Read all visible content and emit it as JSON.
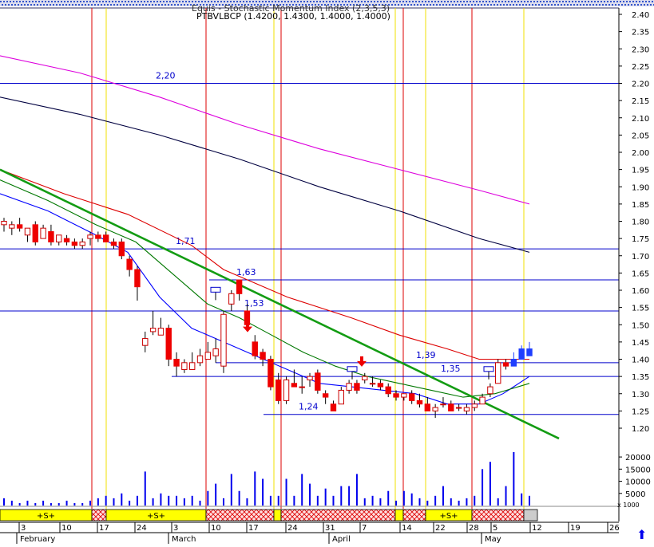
{
  "header": {
    "title": "Equis - Stochastic Momentum Index (2,3,5,3)",
    "subtitle": "PTBVLBCP (1.4200, 1.4300, 1.4000, 1.4000)"
  },
  "colors": {
    "price_up": "#ffffff",
    "price_down": "#ee0000",
    "recent_up": "#1f3fff",
    "hline": "#0000cc",
    "trendline": "#139c13",
    "ma_red": "#dd0000",
    "ma_magenta": "#dd00dd",
    "ma_black": "#000040",
    "ma_blue": "#0000ff",
    "ma_green": "#007700",
    "vline_red": "#dd0000",
    "vline_yellow": "#f0e000",
    "volume": "#0000ee",
    "signal_yellow": "#ffff00",
    "signal_hatch": "#dd0000"
  },
  "axis": {
    "right_ticks": [
      "2.40",
      "2.35",
      "2.30",
      "2.25",
      "2.20",
      "2.15",
      "2.10",
      "2.05",
      "2.00",
      "1.95",
      "1.90",
      "1.85",
      "1.80",
      "1.75",
      "1.70",
      "1.65",
      "1.60",
      "1.55",
      "1.50",
      "1.45",
      "1.40",
      "1.35",
      "1.30",
      "1.25",
      "1.20"
    ],
    "volume_ticks": [
      "20000",
      "15000",
      "10000",
      "5000"
    ],
    "volume_suffix": "x 1000",
    "date_ticks": [
      "3",
      "10",
      "17",
      "24",
      "3",
      "10",
      "17",
      "24",
      "31",
      "7",
      "14",
      "22",
      "28",
      "5",
      "12",
      "19",
      "26"
    ],
    "month_labels": [
      "February",
      "March",
      "April",
      "May"
    ]
  },
  "chart_data": {
    "type": "candlestick",
    "title": "Equis - Stochastic Momentum Index (2,3,5,3)",
    "subtitle": "PTBVLBCP (1.4200, 1.4300, 1.4000, 1.4000)",
    "ylim": [
      1.15,
      2.42
    ],
    "grid": false,
    "candles": [
      {
        "o": 1.79,
        "h": 1.81,
        "l": 1.77,
        "c": 1.8
      },
      {
        "o": 1.78,
        "h": 1.8,
        "l": 1.76,
        "c": 1.79
      },
      {
        "o": 1.79,
        "h": 1.81,
        "l": 1.77,
        "c": 1.78
      },
      {
        "o": 1.76,
        "h": 1.78,
        "l": 1.74,
        "c": 1.78
      },
      {
        "o": 1.79,
        "h": 1.8,
        "l": 1.73,
        "c": 1.74
      },
      {
        "o": 1.75,
        "h": 1.79,
        "l": 1.75,
        "c": 1.78
      },
      {
        "o": 1.77,
        "h": 1.79,
        "l": 1.73,
        "c": 1.74
      },
      {
        "o": 1.74,
        "h": 1.76,
        "l": 1.73,
        "c": 1.76
      },
      {
        "o": 1.75,
        "h": 1.76,
        "l": 1.73,
        "c": 1.74
      },
      {
        "o": 1.74,
        "h": 1.75,
        "l": 1.72,
        "c": 1.73
      },
      {
        "o": 1.73,
        "h": 1.75,
        "l": 1.72,
        "c": 1.74
      },
      {
        "o": 1.75,
        "h": 1.77,
        "l": 1.73,
        "c": 1.76
      },
      {
        "o": 1.76,
        "h": 1.77,
        "l": 1.74,
        "c": 1.75
      },
      {
        "o": 1.76,
        "h": 1.77,
        "l": 1.74,
        "c": 1.74
      },
      {
        "o": 1.74,
        "h": 1.75,
        "l": 1.72,
        "c": 1.73
      },
      {
        "o": 1.74,
        "h": 1.75,
        "l": 1.69,
        "c": 1.7
      },
      {
        "o": 1.69,
        "h": 1.7,
        "l": 1.64,
        "c": 1.66
      },
      {
        "o": 1.66,
        "h": 1.67,
        "l": 1.57,
        "c": 1.61
      },
      {
        "o": 1.44,
        "h": 1.48,
        "l": 1.42,
        "c": 1.46
      },
      {
        "o": 1.48,
        "h": 1.54,
        "l": 1.47,
        "c": 1.49
      },
      {
        "o": 1.47,
        "h": 1.52,
        "l": 1.47,
        "c": 1.49
      },
      {
        "o": 1.49,
        "h": 1.5,
        "l": 1.38,
        "c": 1.4
      },
      {
        "o": 1.4,
        "h": 1.42,
        "l": 1.35,
        "c": 1.38
      },
      {
        "o": 1.37,
        "h": 1.4,
        "l": 1.36,
        "c": 1.39
      },
      {
        "o": 1.37,
        "h": 1.42,
        "l": 1.37,
        "c": 1.39
      },
      {
        "o": 1.39,
        "h": 1.43,
        "l": 1.38,
        "c": 1.41
      },
      {
        "o": 1.4,
        "h": 1.45,
        "l": 1.4,
        "c": 1.42
      },
      {
        "o": 1.41,
        "h": 1.46,
        "l": 1.39,
        "c": 1.43
      },
      {
        "o": 1.38,
        "h": 1.54,
        "l": 1.36,
        "c": 1.53
      },
      {
        "o": 1.56,
        "h": 1.6,
        "l": 1.54,
        "c": 1.59
      },
      {
        "o": 1.63,
        "h": 1.63,
        "l": 1.57,
        "c": 1.59
      },
      {
        "o": 1.54,
        "h": 1.56,
        "l": 1.49,
        "c": 1.5
      },
      {
        "o": 1.45,
        "h": 1.47,
        "l": 1.4,
        "c": 1.41
      },
      {
        "o": 1.42,
        "h": 1.43,
        "l": 1.38,
        "c": 1.4
      },
      {
        "o": 1.4,
        "h": 1.41,
        "l": 1.31,
        "c": 1.32
      },
      {
        "o": 1.34,
        "h": 1.36,
        "l": 1.27,
        "c": 1.28
      },
      {
        "o": 1.28,
        "h": 1.35,
        "l": 1.27,
        "c": 1.34
      },
      {
        "o": 1.33,
        "h": 1.37,
        "l": 1.32,
        "c": 1.32
      },
      {
        "o": 1.32,
        "h": 1.35,
        "l": 1.3,
        "c": 1.32
      },
      {
        "o": 1.34,
        "h": 1.36,
        "l": 1.32,
        "c": 1.35
      },
      {
        "o": 1.36,
        "h": 1.37,
        "l": 1.3,
        "c": 1.31
      },
      {
        "o": 1.3,
        "h": 1.31,
        "l": 1.27,
        "c": 1.29
      },
      {
        "o": 1.27,
        "h": 1.28,
        "l": 1.25,
        "c": 1.25
      },
      {
        "o": 1.27,
        "h": 1.32,
        "l": 1.27,
        "c": 1.31
      },
      {
        "o": 1.31,
        "h": 1.34,
        "l": 1.3,
        "c": 1.33
      },
      {
        "o": 1.33,
        "h": 1.34,
        "l": 1.3,
        "c": 1.31
      },
      {
        "o": 1.34,
        "h": 1.36,
        "l": 1.33,
        "c": 1.35
      },
      {
        "o": 1.33,
        "h": 1.35,
        "l": 1.32,
        "c": 1.33
      },
      {
        "o": 1.33,
        "h": 1.34,
        "l": 1.31,
        "c": 1.32
      },
      {
        "o": 1.32,
        "h": 1.33,
        "l": 1.29,
        "c": 1.3
      },
      {
        "o": 1.3,
        "h": 1.31,
        "l": 1.28,
        "c": 1.29
      },
      {
        "o": 1.29,
        "h": 1.3,
        "l": 1.28,
        "c": 1.3
      },
      {
        "o": 1.3,
        "h": 1.31,
        "l": 1.27,
        "c": 1.28
      },
      {
        "o": 1.28,
        "h": 1.3,
        "l": 1.26,
        "c": 1.27
      },
      {
        "o": 1.27,
        "h": 1.29,
        "l": 1.25,
        "c": 1.25
      },
      {
        "o": 1.25,
        "h": 1.27,
        "l": 1.23,
        "c": 1.26
      },
      {
        "o": 1.27,
        "h": 1.29,
        "l": 1.26,
        "c": 1.27
      },
      {
        "o": 1.27,
        "h": 1.28,
        "l": 1.25,
        "c": 1.25
      },
      {
        "o": 1.26,
        "h": 1.27,
        "l": 1.25,
        "c": 1.26
      },
      {
        "o": 1.25,
        "h": 1.27,
        "l": 1.24,
        "c": 1.26
      },
      {
        "o": 1.26,
        "h": 1.28,
        "l": 1.25,
        "c": 1.27
      },
      {
        "o": 1.27,
        "h": 1.3,
        "l": 1.27,
        "c": 1.29
      },
      {
        "o": 1.3,
        "h": 1.33,
        "l": 1.29,
        "c": 1.32
      },
      {
        "o": 1.33,
        "h": 1.4,
        "l": 1.33,
        "c": 1.39
      },
      {
        "o": 1.39,
        "h": 1.4,
        "l": 1.37,
        "c": 1.38
      },
      {
        "o": 1.38,
        "h": 1.42,
        "l": 1.38,
        "c": 1.4
      },
      {
        "o": 1.4,
        "h": 1.44,
        "l": 1.4,
        "c": 1.43
      },
      {
        "o": 1.43,
        "h": 1.45,
        "l": 1.41,
        "c": 1.41
      }
    ],
    "candle_x_range": [
      5,
      663
    ],
    "moving_averages": [
      {
        "color": "#dd00dd",
        "points": [
          [
            0,
            2.28
          ],
          [
            100,
            2.23
          ],
          [
            200,
            2.16
          ],
          [
            300,
            2.08
          ],
          [
            400,
            2.01
          ],
          [
            500,
            1.95
          ],
          [
            600,
            1.89
          ],
          [
            663,
            1.85
          ]
        ]
      },
      {
        "color": "#000040",
        "points": [
          [
            0,
            2.16
          ],
          [
            100,
            2.11
          ],
          [
            200,
            2.05
          ],
          [
            300,
            1.98
          ],
          [
            400,
            1.9
          ],
          [
            500,
            1.83
          ],
          [
            600,
            1.75
          ],
          [
            663,
            1.71
          ]
        ]
      },
      {
        "color": "#dd0000",
        "points": [
          [
            0,
            1.95
          ],
          [
            80,
            1.88
          ],
          [
            160,
            1.82
          ],
          [
            240,
            1.73
          ],
          [
            280,
            1.66
          ],
          [
            360,
            1.58
          ],
          [
            440,
            1.52
          ],
          [
            500,
            1.47
          ],
          [
            560,
            1.43
          ],
          [
            600,
            1.4
          ],
          [
            663,
            1.4
          ]
        ]
      },
      {
        "color": "#0000ff",
        "points": [
          [
            0,
            1.88
          ],
          [
            60,
            1.83
          ],
          [
            120,
            1.76
          ],
          [
            160,
            1.71
          ],
          [
            200,
            1.58
          ],
          [
            240,
            1.49
          ],
          [
            280,
            1.45
          ],
          [
            320,
            1.41
          ],
          [
            360,
            1.37
          ],
          [
            400,
            1.33
          ],
          [
            440,
            1.32
          ],
          [
            480,
            1.31
          ],
          [
            520,
            1.3
          ],
          [
            560,
            1.27
          ],
          [
            600,
            1.27
          ],
          [
            630,
            1.3
          ],
          [
            663,
            1.35
          ]
        ]
      },
      {
        "color": "#007700",
        "points": [
          [
            0,
            1.92
          ],
          [
            60,
            1.86
          ],
          [
            120,
            1.79
          ],
          [
            170,
            1.74
          ],
          [
            220,
            1.64
          ],
          [
            260,
            1.56
          ],
          [
            300,
            1.52
          ],
          [
            340,
            1.47
          ],
          [
            380,
            1.42
          ],
          [
            420,
            1.38
          ],
          [
            460,
            1.35
          ],
          [
            500,
            1.33
          ],
          [
            540,
            1.31
          ],
          [
            580,
            1.29
          ],
          [
            620,
            1.3
          ],
          [
            663,
            1.33
          ]
        ]
      }
    ],
    "trendline": {
      "from": [
        0,
        1.95
      ],
      "to": [
        700,
        1.17
      ]
    },
    "horizontal_lines": [
      {
        "y": 2.2,
        "label": "2,20",
        "x1": 0,
        "x2": 775,
        "label_x": 195
      },
      {
        "y": 1.72,
        "label": "1,71",
        "x1": 0,
        "x2": 775,
        "label_x": 220
      },
      {
        "y": 1.63,
        "label": "1,63",
        "x1": 262,
        "x2": 775,
        "label_x": 296
      },
      {
        "y": 1.54,
        "label": "1,53",
        "x1": 0,
        "x2": 775,
        "label_x": 306
      },
      {
        "y": 1.39,
        "label": "1,39",
        "x1": 270,
        "x2": 775,
        "label_x": 521
      },
      {
        "y": 1.35,
        "label": "1,35",
        "x1": 215,
        "x2": 775,
        "label_x": 552
      },
      {
        "y": 1.24,
        "label": "1,24",
        "x1": 330,
        "x2": 775,
        "label_x": 374
      }
    ],
    "vertical_lines": [
      {
        "x": 115,
        "color": "#dd0000"
      },
      {
        "x": 133,
        "color": "#f0e000"
      },
      {
        "x": 258,
        "color": "#dd0000"
      },
      {
        "x": 343,
        "color": "#f0e000"
      },
      {
        "x": 352,
        "color": "#dd0000"
      },
      {
        "x": 495,
        "color": "#f0e000"
      },
      {
        "x": 505,
        "color": "#dd0000"
      },
      {
        "x": 533,
        "color": "#f0e000"
      },
      {
        "x": 591,
        "color": "#dd0000"
      },
      {
        "x": 656,
        "color": "#f0e000"
      }
    ],
    "markers": [
      {
        "type": "arrow-down",
        "x": 310,
        "y": 1.49
      },
      {
        "type": "arrow-down",
        "x": 453,
        "y": 1.39
      },
      {
        "type": "flag",
        "x": 270,
        "y": 1.59
      },
      {
        "type": "flag",
        "x": 441,
        "y": 1.36
      },
      {
        "type": "flag",
        "x": 612,
        "y": 1.36
      }
    ],
    "volume": [
      3,
      2,
      1,
      2,
      1,
      2,
      1,
      1,
      2,
      1,
      1,
      2,
      3,
      4,
      3,
      5,
      2,
      4,
      14,
      3,
      5,
      4,
      4,
      3,
      4,
      2,
      6,
      9,
      3,
      13,
      6,
      3,
      14,
      11,
      4,
      4,
      11,
      4,
      13,
      9,
      4,
      7,
      4,
      8,
      8,
      13,
      3,
      4,
      3,
      6,
      2,
      6,
      5,
      3,
      2,
      4,
      8,
      3,
      2,
      3,
      4,
      15,
      18,
      3,
      8,
      22,
      5,
      4
    ],
    "volume_ylim": [
      0,
      22000
    ],
    "signal_bar": [
      {
        "from": 0,
        "to": 115,
        "kind": "yellow",
        "label": "+S+"
      },
      {
        "from": 115,
        "to": 133,
        "kind": "hatch"
      },
      {
        "from": 133,
        "to": 258,
        "kind": "yellow",
        "label": "+S+"
      },
      {
        "from": 258,
        "to": 343,
        "kind": "hatch"
      },
      {
        "from": 343,
        "to": 352,
        "kind": "yellow"
      },
      {
        "from": 352,
        "to": 495,
        "kind": "hatch"
      },
      {
        "from": 495,
        "to": 505,
        "kind": "yellow"
      },
      {
        "from": 505,
        "to": 533,
        "kind": "hatch"
      },
      {
        "from": 533,
        "to": 591,
        "kind": "yellow",
        "label": "+S+"
      },
      {
        "from": 591,
        "to": 656,
        "kind": "hatch"
      },
      {
        "from": 656,
        "to": 673,
        "kind": "gray"
      }
    ],
    "date_tick_x": [
      28,
      79,
      126,
      173,
      219,
      266,
      313,
      362,
      409,
      455,
      505,
      547,
      589,
      619,
      668,
      716,
      765
    ],
    "month_label_x": [
      25,
      215,
      416,
      607
    ]
  }
}
